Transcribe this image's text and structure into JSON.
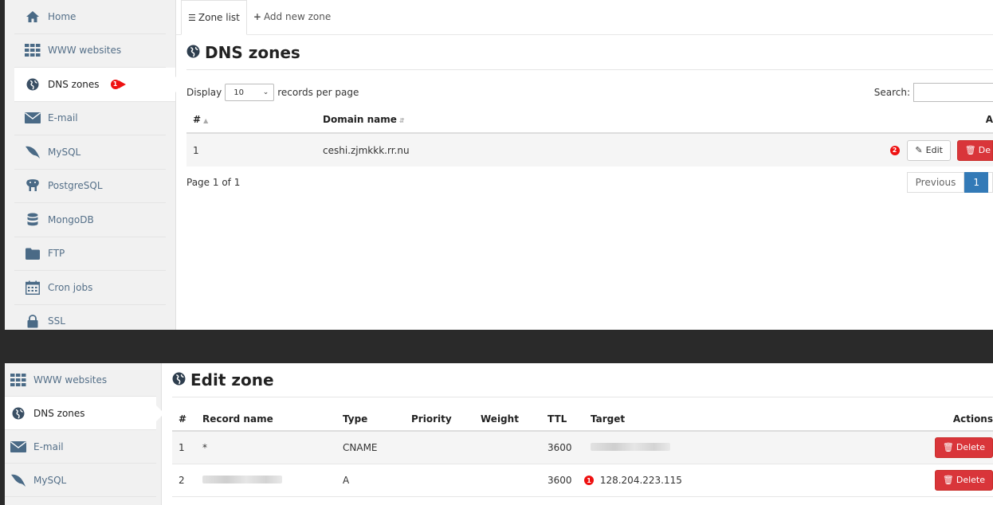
{
  "top": {
    "sidebar": {
      "items": [
        {
          "label": "Home",
          "icon": "home-icon"
        },
        {
          "label": "WWW websites",
          "icon": "grid-icon"
        },
        {
          "label": "DNS zones",
          "icon": "globe-icon"
        },
        {
          "label": "E-mail",
          "icon": "envelope-icon"
        },
        {
          "label": "MySQL",
          "icon": "dolphin-icon"
        },
        {
          "label": "PostgreSQL",
          "icon": "elephant-icon"
        },
        {
          "label": "MongoDB",
          "icon": "database-icon"
        },
        {
          "label": "FTP",
          "icon": "folder-icon"
        },
        {
          "label": "Cron jobs",
          "icon": "calendar-icon"
        },
        {
          "label": "SSL",
          "icon": "lock-icon"
        }
      ],
      "step_marker": "1"
    },
    "tabs": [
      {
        "label": "Zone list",
        "icon": "list-icon"
      },
      {
        "label": "Add new zone",
        "icon": "plus-icon"
      }
    ],
    "title": "DNS zones",
    "display_label": "Display",
    "page_size": "10",
    "records_label": "records per page",
    "search_label": "Search:",
    "columns": {
      "num": "#",
      "domain": "Domain name",
      "actions": "A"
    },
    "rows": [
      {
        "num": "1",
        "domain": "ceshi.zjmkkk.rr.nu",
        "edit": "Edit",
        "delete": "De"
      }
    ],
    "step_marker_2": "2",
    "page_info": "Page 1 of 1",
    "pager": {
      "previous": "Previous",
      "current": "1"
    }
  },
  "bottom": {
    "sidebar": {
      "items": [
        {
          "label": "WWW websites",
          "icon": "grid-icon"
        },
        {
          "label": "DNS zones",
          "icon": "globe-icon"
        },
        {
          "label": "E-mail",
          "icon": "envelope-icon"
        },
        {
          "label": "MySQL",
          "icon": "dolphin-icon"
        }
      ]
    },
    "title": "Edit zone",
    "columns": [
      "#",
      "Record name",
      "Type",
      "Priority",
      "Weight",
      "TTL",
      "Target",
      "Actions"
    ],
    "rows": [
      {
        "num": "1",
        "name": "*",
        "type": "CNAME",
        "priority": "",
        "weight": "",
        "ttl": "3600",
        "target": "",
        "delete": "Delete"
      },
      {
        "num": "2",
        "name": "",
        "type": "A",
        "priority": "",
        "weight": "",
        "ttl": "3600",
        "target": "128.204.223.115",
        "delete": "Delete"
      }
    ],
    "step_marker": "1"
  },
  "colors": {
    "accent": "#337ab7",
    "danger": "#d9353a",
    "marker": "#e11111",
    "icon": "#4a6a86"
  }
}
